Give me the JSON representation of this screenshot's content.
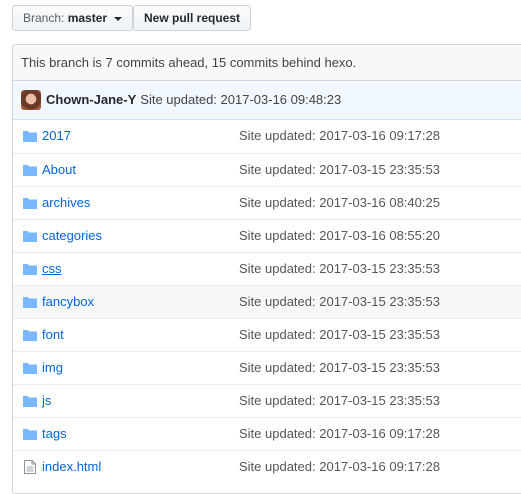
{
  "toolbar": {
    "branch_label": "Branch:",
    "branch_value": "master",
    "new_pr_label": "New pull request"
  },
  "status": {
    "ahead_behind": "This branch is 7 commits ahead, 15 commits behind hexo."
  },
  "last_commit": {
    "author": "Chown-Jane-Y",
    "message": "Site updated: 2017-03-16 09:48:23"
  },
  "files": [
    {
      "name": "2017",
      "type": "folder-icon",
      "message": "Site updated: 2017-03-16 09:17:28"
    },
    {
      "name": "About",
      "type": "folder-icon",
      "message": "Site updated: 2017-03-15 23:35:53"
    },
    {
      "name": "archives",
      "type": "folder-icon",
      "message": "Site updated: 2017-03-16 08:40:25"
    },
    {
      "name": "categories",
      "type": "folder-icon",
      "message": "Site updated: 2017-03-16 08:55:20"
    },
    {
      "name": "css",
      "type": "folder-icon",
      "message": "Site updated: 2017-03-15 23:35:53"
    },
    {
      "name": "fancybox",
      "type": "folder-icon",
      "message": "Site updated: 2017-03-15 23:35:53"
    },
    {
      "name": "font",
      "type": "folder-icon",
      "message": "Site updated: 2017-03-15 23:35:53"
    },
    {
      "name": "img",
      "type": "folder-icon",
      "message": "Site updated: 2017-03-15 23:35:53"
    },
    {
      "name": "js",
      "type": "folder-icon",
      "message": "Site updated: 2017-03-15 23:35:53"
    },
    {
      "name": "tags",
      "type": "folder-icon",
      "message": "Site updated: 2017-03-16 09:17:28"
    },
    {
      "name": "index.html",
      "type": "file-icon",
      "message": "Site updated: 2017-03-16 09:17:28"
    }
  ],
  "colors": {
    "link": "#0366d6",
    "folder": "#79b8ff",
    "commit_bg": "#f1f8ff"
  }
}
